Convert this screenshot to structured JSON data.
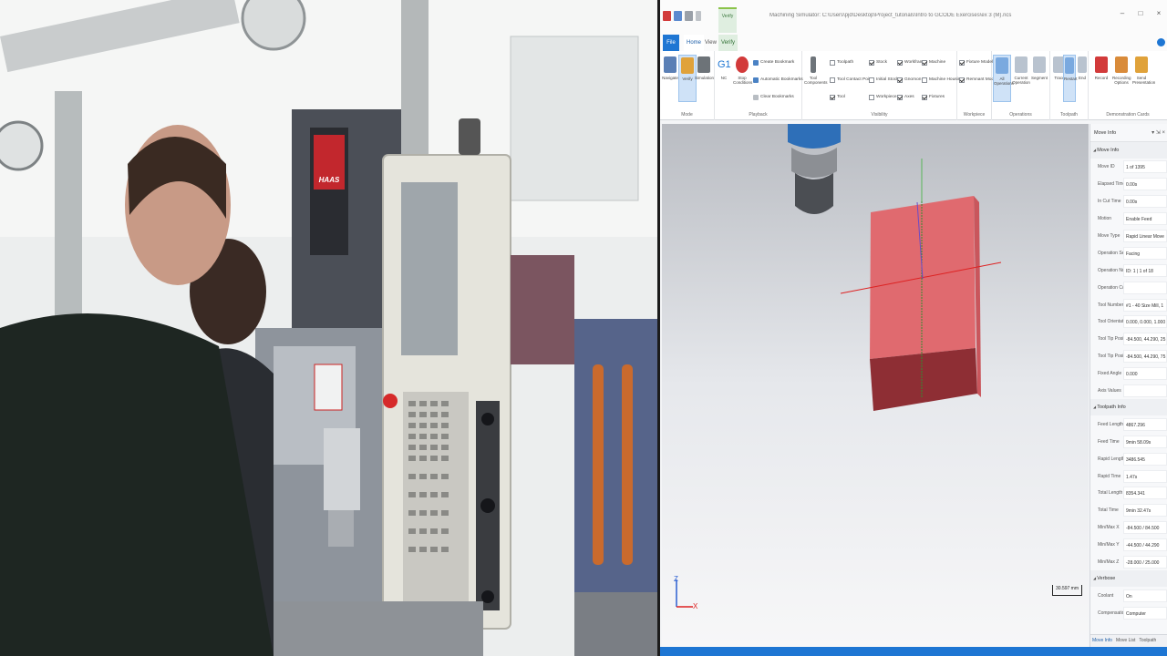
{
  "app": {
    "title": "Machining Simulator: C:\\Users\\pjd\\Desktop\\Project_tutorials\\Intro to GCODE Exercises\\ex 3 (M).ncs",
    "verify_context_tab": "Verify",
    "window_controls": [
      "–",
      "□",
      "×"
    ]
  },
  "tabs": {
    "file": "File",
    "home": "Home",
    "view": "View",
    "verify": "Verify"
  },
  "ribbon": {
    "groups": {
      "mode": "Mode",
      "playback": "Playback",
      "visibility": "Visibility",
      "workpiece": "Workpiece",
      "operations": "Operations",
      "toolpath": "Toolpath",
      "demonstration": "Demonstration Cards"
    },
    "buttons": {
      "navigate": "Navigate",
      "verify": "Verify",
      "simulation": "Simulation",
      "nc": "NC",
      "stop_conditions": "Stop Conditions",
      "tool_components": "Tool Components",
      "all_operations": "All Operations",
      "current_operation": "Current Operation",
      "segment": "Segment",
      "trace": "Trace",
      "restart": "Restart",
      "end": "End",
      "record": "Record",
      "recording_options": "Recording Options",
      "send_presentation": "Send Presentation"
    },
    "playback_items": [
      "Create Bookmark",
      "Automatic Bookmarks",
      "Clear Bookmarks"
    ],
    "visibility_col1": [
      "Toolpath",
      "Tool Contact Point",
      "Tool"
    ],
    "visibility_col2": [
      "Stock",
      "Initial Stock",
      "Workpiece"
    ],
    "visibility_col3": [
      "Workframe",
      "Gnomon",
      "Axes"
    ],
    "visibility_col4": [
      "Machine",
      "Machine Housing",
      "Fixtures"
    ],
    "workpiece_items": [
      "Fixture Model",
      "Remnant Model"
    ]
  },
  "viewport": {
    "scale_label": "30.597 mm",
    "gnomon_z": "Z",
    "gnomon_x": "X"
  },
  "panel": {
    "title": "Move Info",
    "controls": "▾ ⇲ ×",
    "move_info_header": "Move Info",
    "move_info": [
      {
        "k": "Move ID",
        "v": "1 of 1395"
      },
      {
        "k": "Elapsed Time",
        "v": "0.00s"
      },
      {
        "k": "In Cut Time",
        "v": "0.00s"
      },
      {
        "k": "Motion",
        "v": "Enable Feed"
      },
      {
        "k": "Move Type",
        "v": "Rapid Linear Move"
      },
      {
        "k": "Operation Se...",
        "v": "Facing"
      },
      {
        "k": "Operation Nu...",
        "v": "ID: 1 | 1 of 18"
      },
      {
        "k": "Operation Co...",
        "v": ""
      },
      {
        "k": "Tool Number",
        "v": "#1 - 40 Size Mill, 1"
      },
      {
        "k": "Tool Orientat...",
        "v": "0.000, 0.000, 1.000"
      },
      {
        "k": "Tool Tip Positi...",
        "v": "-84.500, 44.290, 25"
      },
      {
        "k": "Tool Tip Positi...",
        "v": "-84.500, 44.290, 75"
      },
      {
        "k": "Fixed Angle",
        "v": "0.000"
      },
      {
        "k": "Axis Values",
        "v": ""
      }
    ],
    "toolpath_header": "Toolpath Info",
    "toolpath_info": [
      {
        "k": "Feed Length",
        "v": "4867.296"
      },
      {
        "k": "Feed Time",
        "v": "9min 58.09s"
      },
      {
        "k": "Rapid Length",
        "v": "3486.545"
      },
      {
        "k": "Rapid Time",
        "v": "1.47s"
      },
      {
        "k": "Total Length",
        "v": "8354.341"
      },
      {
        "k": "Total Time",
        "v": "9min 32.47s"
      },
      {
        "k": "Min/Max X",
        "v": "-84.500 / 84.500"
      },
      {
        "k": "Min/Max Y",
        "v": "-44.500 / 44.290"
      },
      {
        "k": "Min/Max Z",
        "v": "-28.000 / 25.000"
      }
    ],
    "verbose_header": "Verbose",
    "verbose": [
      {
        "k": "Coolant",
        "v": "On"
      },
      {
        "k": "Compensatio...",
        "v": "Computer"
      }
    ],
    "bottom_tabs": [
      "Move Info",
      "Move List",
      "Toolpath"
    ]
  },
  "camera": {
    "machine_brand": "HAAS"
  },
  "colors": {
    "accent_blue": "#1e76d3",
    "block_top": "#e06a6f",
    "block_bottom": "#8e2e34",
    "haas_red": "#c2272d"
  }
}
